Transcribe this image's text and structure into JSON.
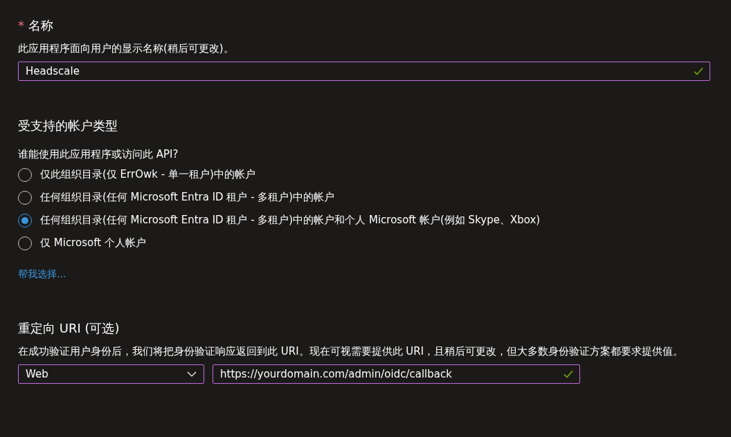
{
  "name_section": {
    "title": "名称",
    "required_mark": "*",
    "description": "此应用程序面向用户的显示名称(稍后可更改)。",
    "input": {
      "value": "Headscale",
      "valid": true
    }
  },
  "account_types": {
    "title": "受支持的帐户类型",
    "question": "谁能使用此应用程序或访问此 API?",
    "options": [
      {
        "label": "仅此组织目录(仅 ErrOwk - 单一租户)中的帐户",
        "selected": false
      },
      {
        "label": "任何组织目录(任何 Microsoft Entra ID 租户 - 多租户)中的帐户",
        "selected": false
      },
      {
        "label": "任何组织目录(任何 Microsoft Entra ID 租户 - 多租户)中的帐户和个人 Microsoft 帐户(例如 Skype、Xbox)",
        "selected": true
      },
      {
        "label": "仅 Microsoft 个人帐户",
        "selected": false
      }
    ],
    "help_link": "帮我选择..."
  },
  "redirect_uri": {
    "title": "重定向 URI (可选)",
    "description": "在成功验证用户身份后，我们将把身份验证响应返回到此 URI。现在可视需要提供此 URI，且稍后可更改，但大多数身份验证方案都要求提供值。",
    "platform": "Web",
    "uri": {
      "value": "https://yourdomain.com/admin/oidc/callback",
      "valid": true
    }
  }
}
